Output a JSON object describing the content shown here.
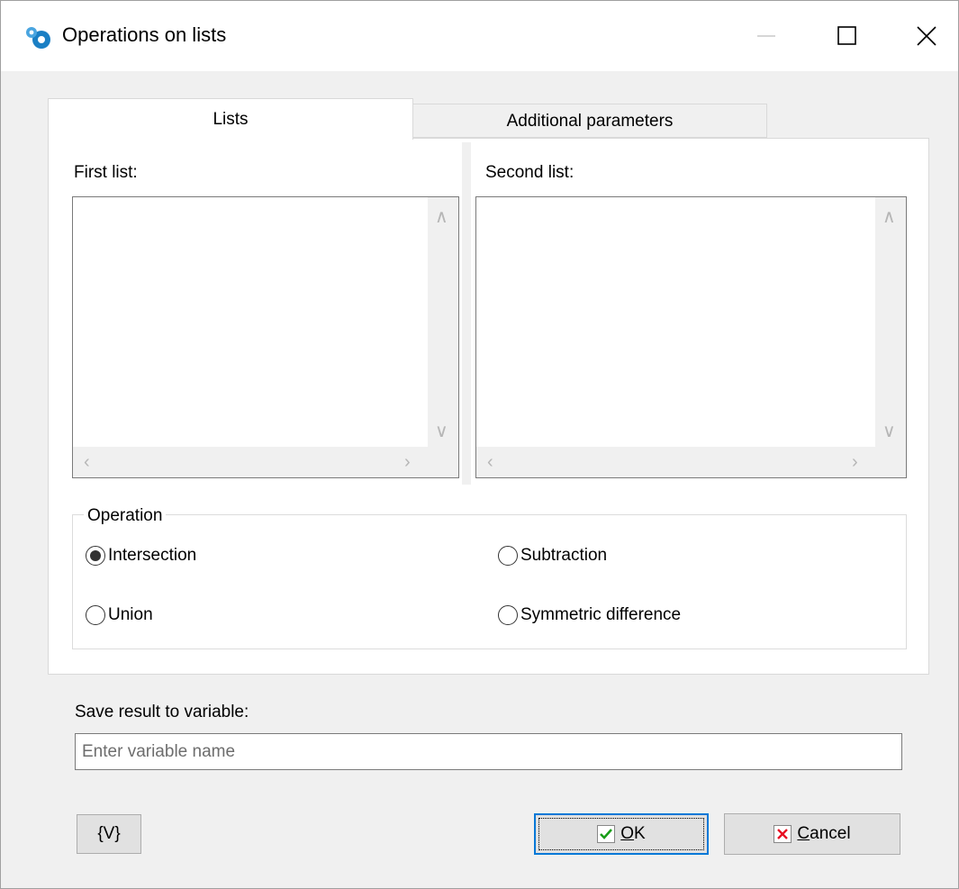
{
  "window": {
    "title": "Operations on lists"
  },
  "tabs": [
    {
      "label": "Lists",
      "active": true
    },
    {
      "label": "Additional parameters",
      "active": false
    }
  ],
  "lists": {
    "first_label": "First list:",
    "second_label": "Second list:"
  },
  "operation": {
    "title": "Operation",
    "options": [
      {
        "label": "Intersection",
        "selected": true
      },
      {
        "label": "Subtraction",
        "selected": false
      },
      {
        "label": "Union",
        "selected": false
      },
      {
        "label": "Symmetric difference",
        "selected": false
      }
    ]
  },
  "result": {
    "label": "Save result to variable:",
    "placeholder": "Enter variable name",
    "value": ""
  },
  "buttons": {
    "variables": "{V}",
    "ok_accel": "O",
    "ok_rest": "K",
    "cancel_accel": "C",
    "cancel_rest": "ancel"
  },
  "colors": {
    "ok_check": "#1a9e1a",
    "cancel_x": "#e81123",
    "focus_border": "#0078d7"
  }
}
